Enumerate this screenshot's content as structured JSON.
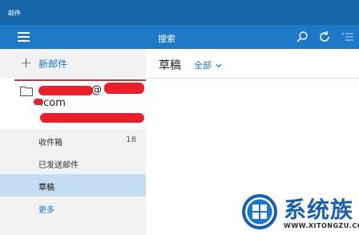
{
  "window": {
    "title": "邮件"
  },
  "navbar": {
    "search_label": "搜索"
  },
  "sidebar": {
    "new_mail_label": "新邮件",
    "account": {
      "email_line1_visible": "@",
      "email_line2_visible": ".com"
    },
    "folders": [
      {
        "label": "收件箱",
        "count": "18"
      },
      {
        "label": "已发送邮件",
        "count": ""
      },
      {
        "label": "草稿",
        "count": ""
      },
      {
        "label": "更多",
        "count": ""
      }
    ]
  },
  "content": {
    "folder_title": "草稿",
    "filter_label": "全部"
  },
  "watermark": {
    "title": "系统族",
    "url": "WWW.XITONGZU.COM"
  },
  "colors": {
    "title_bar": "#1565a8",
    "nav_bar": "#1e78c8",
    "accent": "#1e78c8",
    "selected_folder": "#c5ddf2",
    "redaction": "#e8202a"
  },
  "icons": [
    "hamburger-icon",
    "search-icon",
    "sync-icon",
    "select-mode-icon",
    "folder-icon",
    "chevron-down-icon",
    "plus-icon"
  ]
}
